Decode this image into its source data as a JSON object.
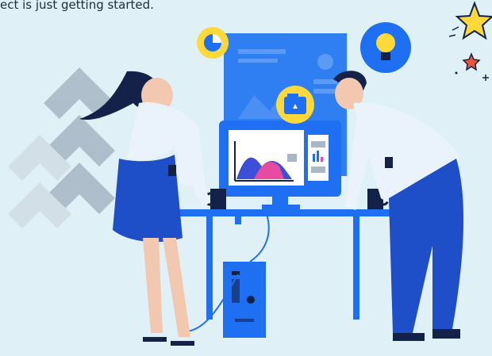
{
  "caption": "ect is just getting started.",
  "colors": {
    "background": "#dff1f7",
    "primary_blue": "#1f6ff2",
    "dark_navy": "#14224a",
    "accent_pink": "#e84aa0",
    "accent_yellow": "#ffd83a",
    "chevron_gray": "#a9b7c7"
  },
  "icons": [
    "pie-chart-icon",
    "lightbulb-icon",
    "folder-icon",
    "star-icon"
  ]
}
